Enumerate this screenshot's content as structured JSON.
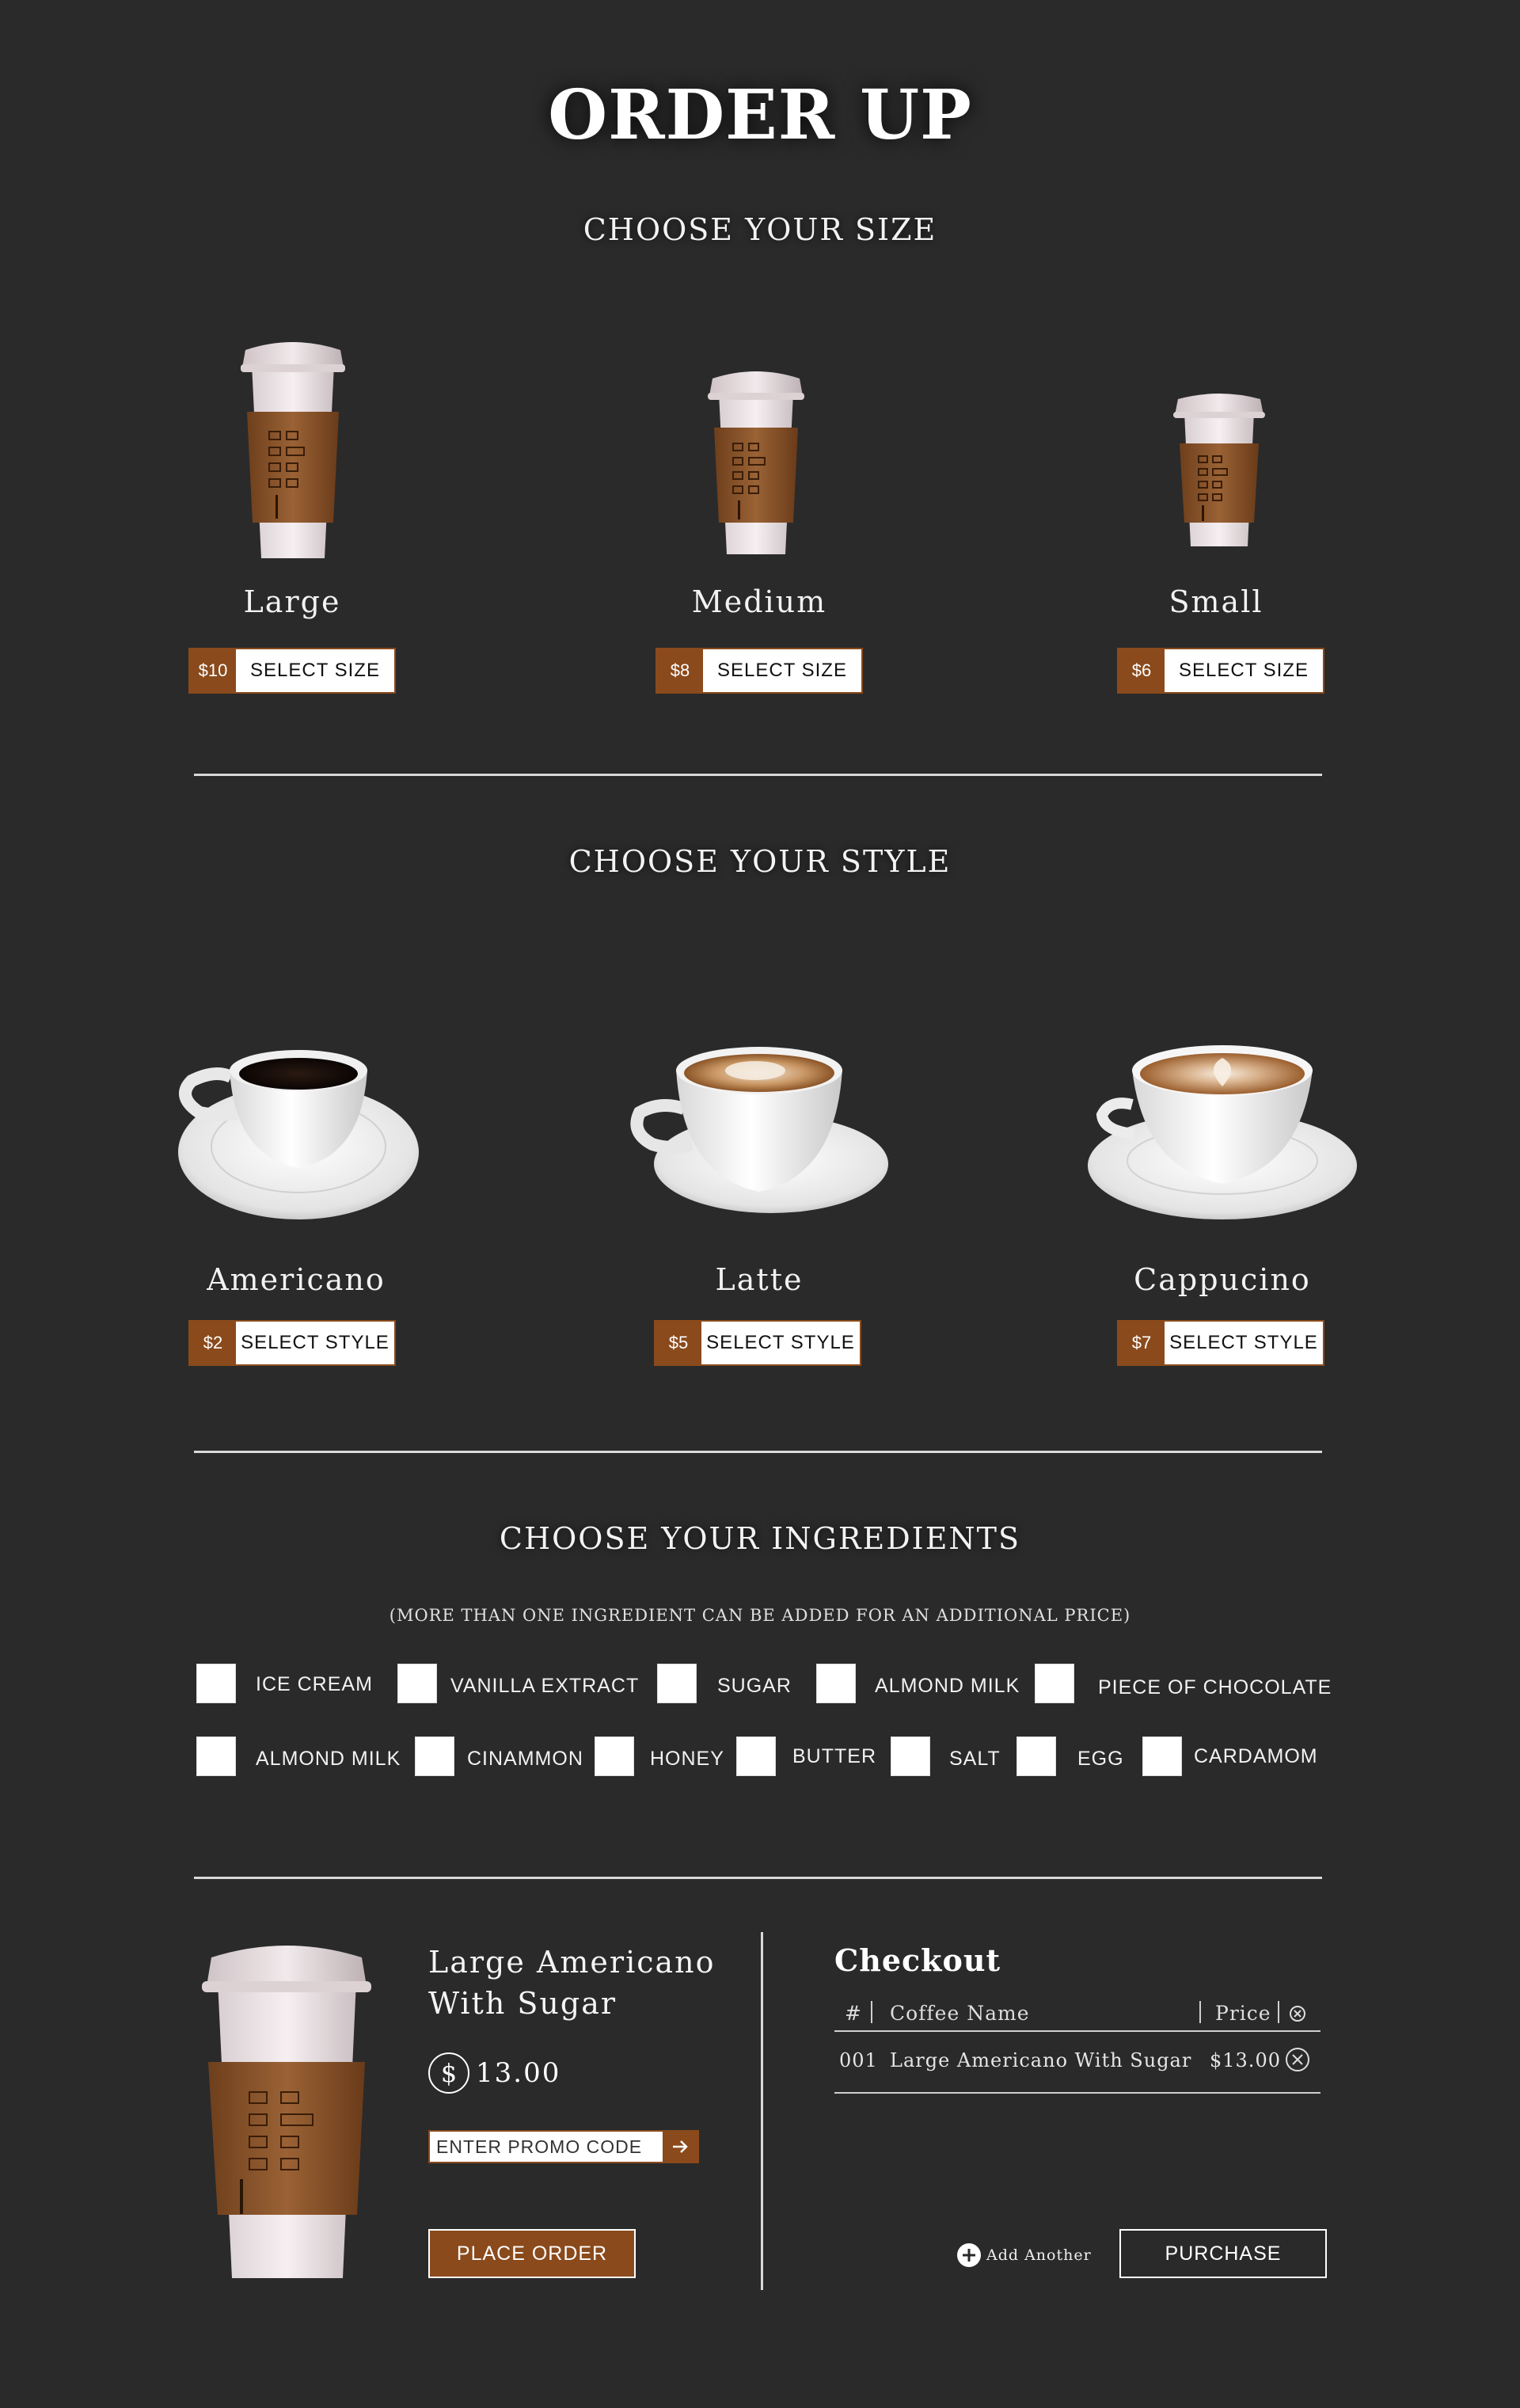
{
  "header": {
    "title": "ORDER UP"
  },
  "size_section": {
    "heading": "CHOOSE YOUR SIZE",
    "items": [
      {
        "name": "Large",
        "price": "$10",
        "button": "SELECT SIZE"
      },
      {
        "name": "Medium",
        "price": "$8",
        "button": "SELECT SIZE"
      },
      {
        "name": "Small",
        "price": "$6",
        "button": "SELECT SIZE"
      }
    ]
  },
  "style_section": {
    "heading": "CHOOSE YOUR STYLE",
    "items": [
      {
        "name": "Americano",
        "price": "$2",
        "button": "SELECT STYLE"
      },
      {
        "name": "Latte",
        "price": "$5",
        "button": "SELECT STYLE"
      },
      {
        "name": "Cappucino",
        "price": "$7",
        "button": "SELECT STYLE"
      }
    ]
  },
  "ingredients_section": {
    "heading": "CHOOSE YOUR INGREDIENTS",
    "note": "(MORE THAN ONE INGREDIENT CAN BE ADDED FOR AN ADDITIONAL PRICE)",
    "row1": [
      "ICE CREAM",
      "VANILLA EXTRACT",
      "SUGAR",
      "ALMOND MILK",
      "PIECE OF CHOCOLATE"
    ],
    "row2": [
      "ALMOND MILK",
      "CINAMMON",
      "HONEY",
      "BUTTER",
      "SALT",
      "EGG",
      "CARDAMOM"
    ]
  },
  "summary": {
    "name_line1": "Large Americano",
    "name_line2": "With Sugar",
    "currency_symbol": "$",
    "price": "13.00",
    "promo_placeholder": "ENTER PROMO CODE",
    "place_order": "PLACE ORDER"
  },
  "checkout": {
    "title": "Checkout",
    "columns": [
      "#",
      "Coffee Name",
      "Price"
    ],
    "rows": [
      {
        "id": "001",
        "name": "Large Americano With Sugar",
        "price": "$13.00"
      }
    ],
    "add_another": "Add Another",
    "purchase": "PURCHASE"
  },
  "colors": {
    "background": "#2a2a2a",
    "accent": "#8a4a1c",
    "text": "#ffffff"
  },
  "icons": [
    "plus-circle-icon",
    "remove-circle-icon",
    "arrow-right-icon",
    "dollar-circle-icon"
  ]
}
